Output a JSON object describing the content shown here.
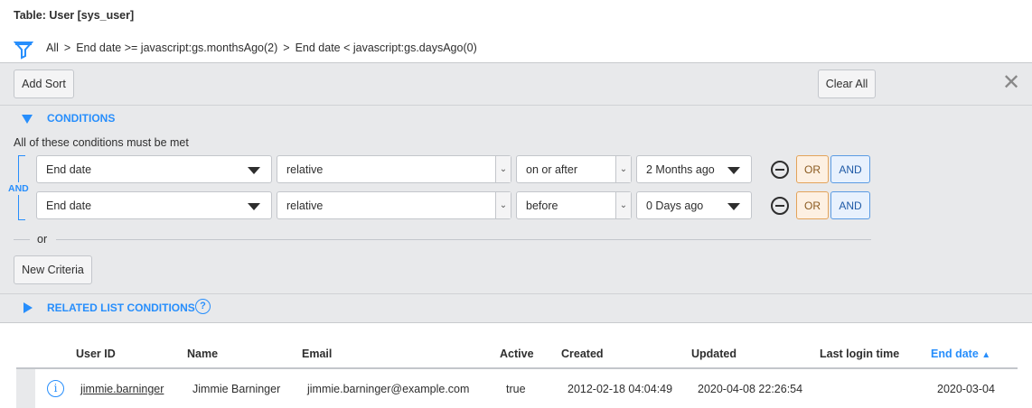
{
  "title": "Table: User [sys_user]",
  "breadcrumb": {
    "all": "All",
    "sep": ">",
    "crumb1": "End date >= javascript:gs.monthsAgo(2)",
    "crumb2": "End date < javascript:gs.daysAgo(0)"
  },
  "toolbar": {
    "add_sort": "Add Sort",
    "clear_all": "Clear All",
    "close": "✕"
  },
  "conditions": {
    "header": "CONDITIONS",
    "subtitle": "All of these conditions must be met",
    "and_label": "AND",
    "rows": [
      {
        "field": "End date",
        "type": "relative",
        "operator": "on or after",
        "value": "2 Months ago",
        "or": "OR",
        "and": "AND"
      },
      {
        "field": "End date",
        "type": "relative",
        "operator": "before",
        "value": "0 Days ago",
        "or": "OR",
        "and": "AND"
      }
    ],
    "or_label": "or",
    "new_criteria": "New Criteria"
  },
  "related": {
    "header": "RELATED LIST CONDITIONS",
    "help": "?"
  },
  "table": {
    "columns": [
      "User ID",
      "Name",
      "Email",
      "Active",
      "Created",
      "Updated",
      "Last login time",
      "End date"
    ],
    "sort_indicator": "▲",
    "rows": [
      {
        "user_id": "jimmie.barninger",
        "name": "Jimmie Barninger",
        "email": "jimmie.barninger@example.com",
        "active": "true",
        "created": "2012-02-18 04:04:49",
        "updated": "2020-04-08 22:26:54",
        "last_login": "",
        "end_date": "2020-03-04"
      }
    ]
  },
  "colors": {
    "accent": "#278efc",
    "panel": "#e8e9eb"
  }
}
